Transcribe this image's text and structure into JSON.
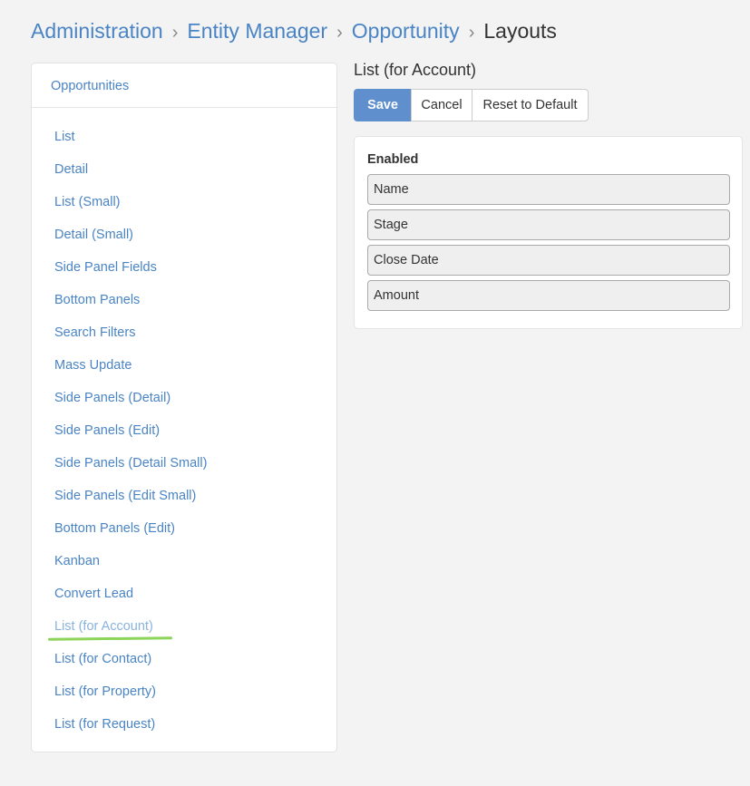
{
  "breadcrumb": {
    "items": [
      "Administration",
      "Entity Manager",
      "Opportunity"
    ],
    "current": "Layouts",
    "separator": "›"
  },
  "sidebar": {
    "header": "Opportunities",
    "items": [
      {
        "label": "List"
      },
      {
        "label": "Detail"
      },
      {
        "label": "List (Small)"
      },
      {
        "label": "Detail (Small)"
      },
      {
        "label": "Side Panel Fields"
      },
      {
        "label": "Bottom Panels"
      },
      {
        "label": "Search Filters"
      },
      {
        "label": "Mass Update"
      },
      {
        "label": "Side Panels (Detail)"
      },
      {
        "label": "Side Panels (Edit)"
      },
      {
        "label": "Side Panels (Detail Small)"
      },
      {
        "label": "Side Panels (Edit Small)"
      },
      {
        "label": "Bottom Panels (Edit)"
      },
      {
        "label": "Kanban"
      },
      {
        "label": "Convert Lead"
      },
      {
        "label": "List (for Account)",
        "active": true
      },
      {
        "label": "List (for Contact)"
      },
      {
        "label": "List (for Property)"
      },
      {
        "label": "List (for Request)"
      }
    ]
  },
  "main": {
    "title": "List (for Account)",
    "buttons": {
      "save": "Save",
      "cancel": "Cancel",
      "reset": "Reset to Default"
    },
    "enabled": {
      "title": "Enabled",
      "fields": [
        "Name",
        "Stage",
        "Close Date",
        "Amount"
      ]
    }
  },
  "colors": {
    "link": "#4a84c4",
    "active_link": "#89b3dd",
    "primary_button": "#5f8fcc",
    "highlight_underline": "#8dd45a",
    "background": "#f3f3f3"
  }
}
